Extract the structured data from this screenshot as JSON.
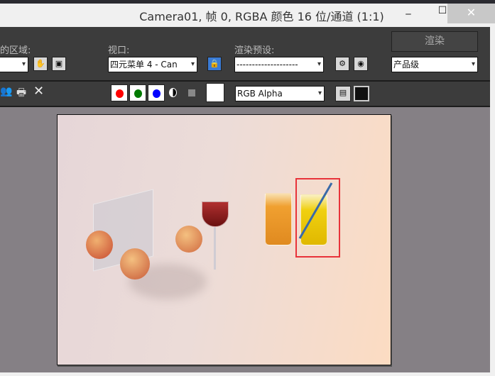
{
  "window": {
    "title": "Camera01, 帧 0, RGBA 颜色 16 位/通道 (1:1)",
    "minimize": "‒",
    "maximize": "☐",
    "close": "✕"
  },
  "toolbar": {
    "area_label": "的区域:",
    "viewport_label": "视口:",
    "viewport_value": "四元菜单 4 - Can",
    "preset_label": "渲染预设:",
    "preset_value": "--------------------",
    "render_button": "渲染",
    "quality_value": "产品级",
    "channel_value": "RGB Alpha"
  },
  "colors": {
    "red": "#ff0000",
    "green": "#007a00",
    "blue": "#0000ff",
    "highlight": "#e8333a"
  }
}
